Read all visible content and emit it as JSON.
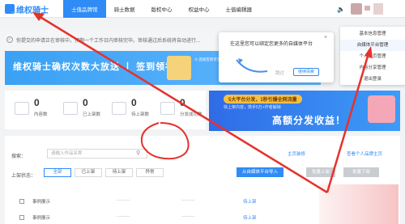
{
  "brand": {
    "name": "维权骑士",
    "sub": "RIGHTKNIGHTS.COM"
  },
  "nav": {
    "items": [
      {
        "label": "士值品牌馆",
        "active": true
      },
      {
        "label": "骑士数据",
        "active": false
      },
      {
        "label": "版权中心",
        "active": false
      },
      {
        "label": "权益中心",
        "active": false
      },
      {
        "label": "士值编辑器",
        "active": false
      }
    ]
  },
  "notice": {
    "text": "你提交的申请正在审核中，预期一个工作日内审核完毕。审核通过后系统将自动进行..."
  },
  "banner": {
    "title": "维权骑士确权次数大放送 丨 签到领福利",
    "note": "① 连续签到可领 ② 之后每天签到 ③ 更多精彩"
  },
  "stats": [
    {
      "value": "0",
      "label": "内容数"
    },
    {
      "value": "0",
      "label": "已上架数"
    },
    {
      "value": "0",
      "label": "待上架数"
    },
    {
      "value": "0",
      "label": "分发成功数"
    }
  ],
  "promo": {
    "pill": "5大平台分发，1秒引爆全网流量",
    "sub": "快上架内容，携手5万+作者解锁",
    "big": "高额分发收益！"
  },
  "search": {
    "label": "搜索：",
    "placeholder": "请输入作品名称"
  },
  "links": {
    "main": "主页装修",
    "all": "查看个人品牌主页"
  },
  "filter": {
    "label": "上架状态：",
    "chips": [
      "全部",
      "已上架",
      "待上架",
      "异常"
    ],
    "import_button": "从自媒体平台导入",
    "btn_a": "批量上架",
    "btn_b": "批量下架"
  },
  "rows": [
    {
      "name": "事例展示",
      "status": "待上架"
    },
    {
      "name": "事例展示",
      "status": "待上架"
    }
  ],
  "menu": {
    "items": [
      "基本信息管理",
      "自媒体平台管理",
      "个人主页管理",
      "内容分享管理",
      "退出登录"
    ],
    "selected_index": 1
  },
  "popup": {
    "text": "在这里您可以绑定您更多的自媒体平台",
    "cancel": "跳过",
    "ok": "继续探索"
  },
  "colors": {
    "brand": "#2f8bf6",
    "annotation": "#e5322d"
  }
}
